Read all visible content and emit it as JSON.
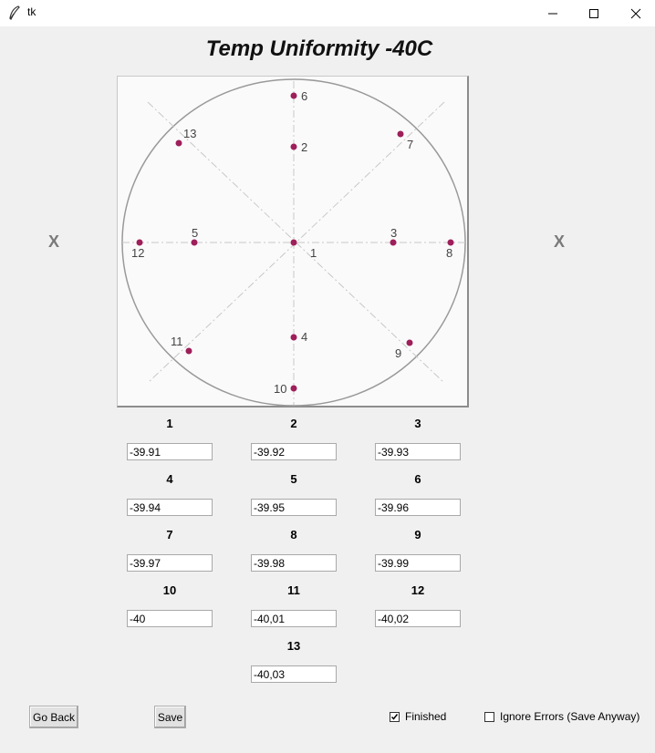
{
  "window": {
    "title": "tk"
  },
  "heading": "Temp Uniformity -40C",
  "side_markers": {
    "left": "X",
    "right": "X"
  },
  "points": [
    {
      "label": "1",
      "value": "-39.91"
    },
    {
      "label": "2",
      "value": "-39.92"
    },
    {
      "label": "3",
      "value": "-39.93"
    },
    {
      "label": "4",
      "value": "-39.94"
    },
    {
      "label": "5",
      "value": "-39.95"
    },
    {
      "label": "6",
      "value": "-39.96"
    },
    {
      "label": "7",
      "value": "-39.97"
    },
    {
      "label": "8",
      "value": "-39.98"
    },
    {
      "label": "9",
      "value": "-39.99"
    },
    {
      "label": "10",
      "value": "-40"
    },
    {
      "label": "11",
      "value": "-40,01"
    },
    {
      "label": "12",
      "value": "-40,02"
    },
    {
      "label": "13",
      "value": "-40,03"
    }
  ],
  "buttons": {
    "go_back": "Go Back",
    "save": "Save"
  },
  "checkboxes": {
    "finished": {
      "label": "Finished",
      "checked": true
    },
    "ignore_errors": {
      "label": "Ignore Errors (Save Anyway)",
      "checked": false
    }
  },
  "colors": {
    "point": "#9e1f5a",
    "circle": "#999999",
    "guides": "#c8c8c8"
  }
}
